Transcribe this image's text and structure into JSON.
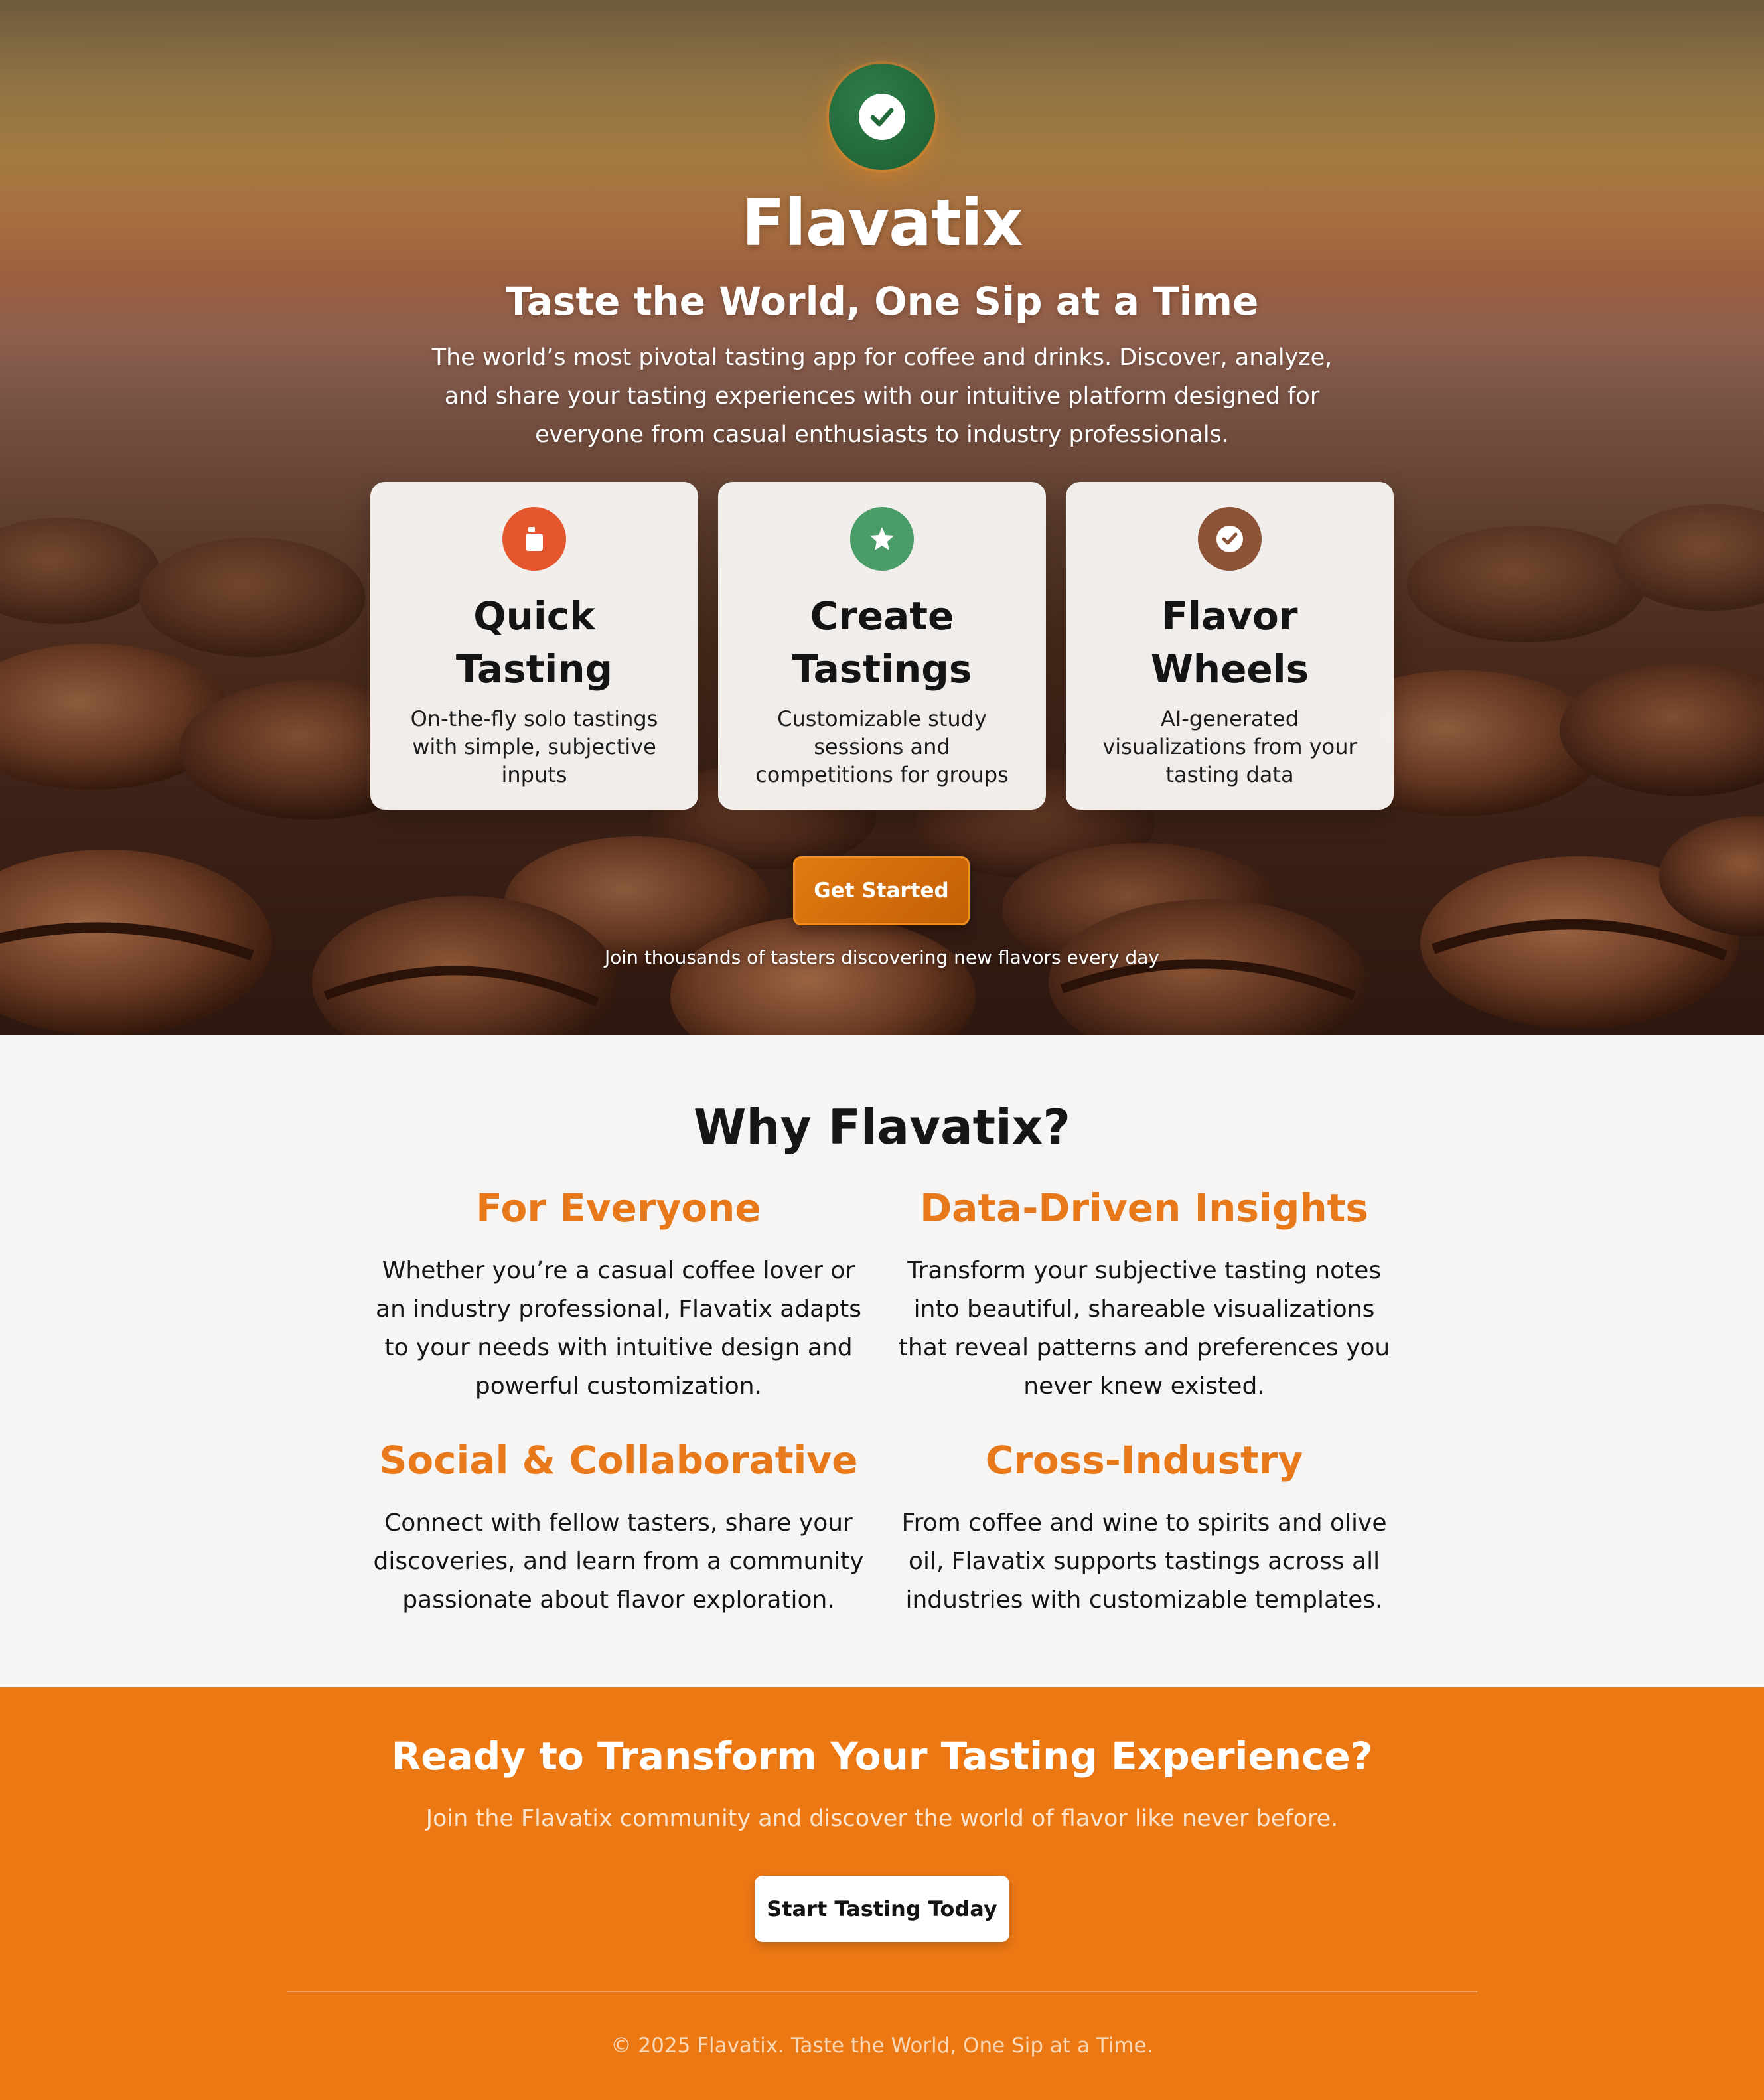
{
  "hero": {
    "brand": "Flavatix",
    "tagline": "Taste the World, One Sip at a Time",
    "intro": "The world’s most pivotal tasting app for coffee and drinks. Discover, analyze, and share your tasting experiences with our intuitive platform designed for everyone from casual enthusiasts to industry professionals.",
    "badge_icon": "check-circle-icon",
    "cards": [
      {
        "title": "Quick Tasting",
        "text": "On-the-fly solo tastings with simple, subjective inputs",
        "icon": "cup-icon",
        "color": "#e4572e"
      },
      {
        "title": "Create Tastings",
        "text": "Customizable study sessions and competitions for groups",
        "icon": "star-icon",
        "color": "#4a9d68"
      },
      {
        "title": "Flavor Wheels",
        "text": "AI-generated visualizations from your tasting data",
        "icon": "check-icon",
        "color": "#8b5235"
      }
    ],
    "cta_label": "Get Started",
    "join_text": "Join thousands of tasters discovering new flavors every day"
  },
  "why": {
    "title": "Why Flavatix?",
    "items": [
      {
        "title": "For Everyone",
        "text": "Whether you’re a casual coffee lover or an industry professional, Flavatix adapts to your needs with intuitive design and powerful customization."
      },
      {
        "title": "Data-Driven Insights",
        "text": "Transform your subjective tasting notes into beautiful, shareable visualizations that reveal patterns and preferences you never knew existed."
      },
      {
        "title": "Social & Collaborative",
        "text": "Connect with fellow tasters, share your discoveries, and learn from a community passionate about flavor exploration."
      },
      {
        "title": "Cross-Industry",
        "text": "From coffee and wine to spirits and olive oil, Flavatix supports tastings across all industries with customizable templates."
      }
    ]
  },
  "cta": {
    "title": "Ready to Transform Your Tasting Experience?",
    "subtitle": "Join the Flavatix community and discover the world of flavor like never before.",
    "button_label": "Start Tasting Today",
    "footer": "© 2025 Flavatix. Taste the World, One Sip at a Time."
  },
  "colors": {
    "accent_orange": "#ec7814",
    "brand_green": "#236a3b",
    "heading_orange": "#e8791a"
  }
}
